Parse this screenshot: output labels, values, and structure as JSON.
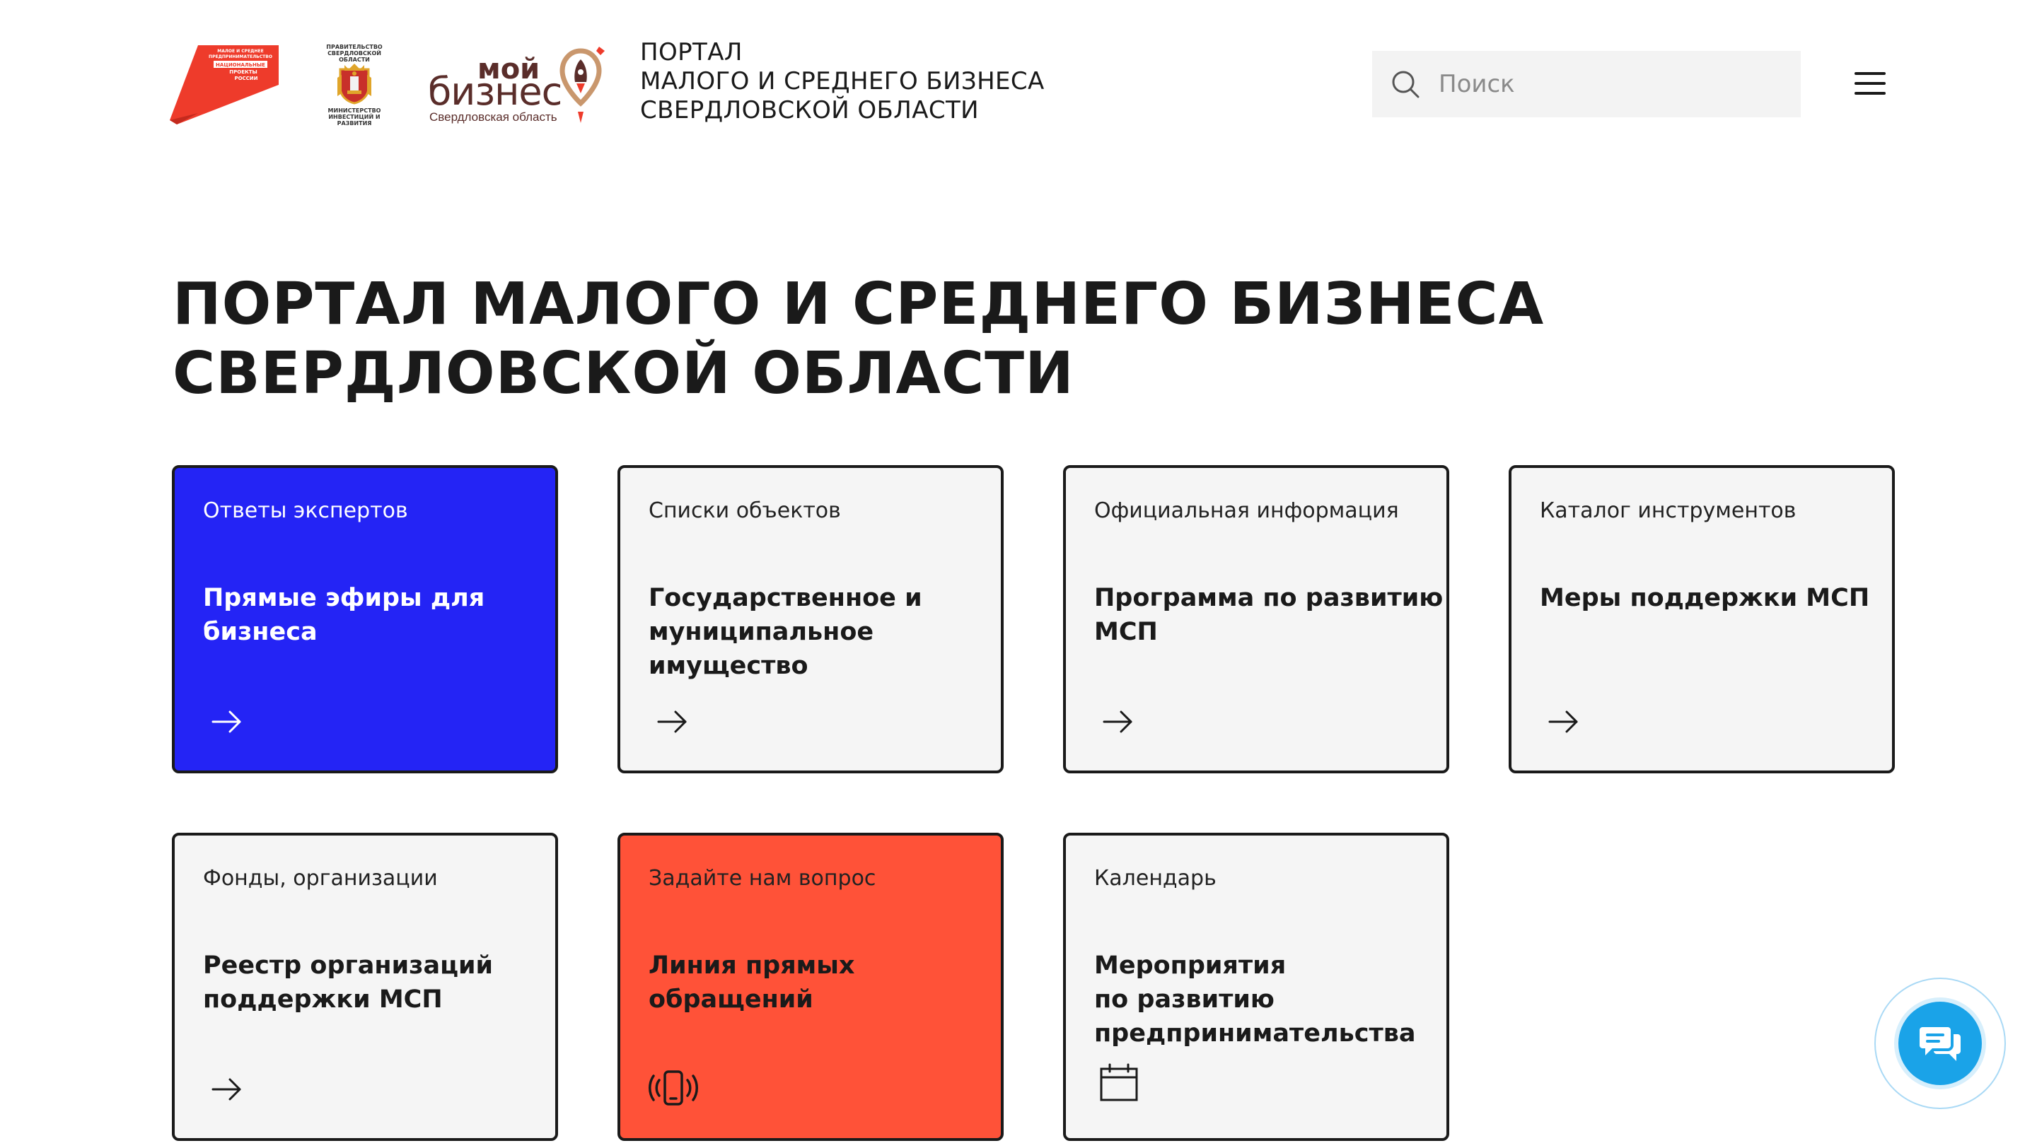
{
  "header": {
    "logo_np_lines": [
      "МАЛОЕ И СРЕДНЕЕ",
      "ПРЕДПРИНИМАТЕЛЬСТВО",
      "НАЦИОНАЛЬНЫЕ",
      "ПРОЕКТЫ",
      "РОССИИ"
    ],
    "gov_top": "ПРАВИТЕЛЬСТВО СВЕРДЛОВСКОЙ ОБЛАСТИ",
    "gov_bottom": "МИНИСТЕРСТВО ИНВЕСТИЦИЙ И РАЗВИТИЯ",
    "mb_moi": "мой",
    "mb_biz": "бизнес",
    "mb_region": "Свердловская область",
    "portal_title_lines": [
      "ПОРТАЛ",
      "МАЛОГО И СРЕДНЕГО БИЗНЕСА",
      "СВЕРДЛОВСКОЙ ОБЛАСТИ"
    ],
    "search_placeholder": "Поиск"
  },
  "main": {
    "title_lines": [
      "ПОРТАЛ МАЛОГО И СРЕДНЕГО БИЗНЕСА",
      "СВЕРДЛОВСКОЙ ОБЛАСТИ"
    ]
  },
  "cards": [
    {
      "category": "Ответы экспертов",
      "title_lines": [
        "Прямые эфиры для",
        "бизнеса"
      ],
      "icon": "arrow-right-icon"
    },
    {
      "category": "Списки объектов",
      "title_lines": [
        "Государственное и",
        "муниципальное",
        "имущество"
      ],
      "icon": "arrow-right-icon"
    },
    {
      "category": "Официальная информация",
      "title_lines": [
        "Программа по развитию",
        "МСП"
      ],
      "icon": "arrow-right-icon"
    },
    {
      "category": "Каталог инструментов",
      "title_lines": [
        "Меры поддержки МСП"
      ],
      "icon": "arrow-right-icon"
    },
    {
      "category": "Фонды, организации",
      "title_lines": [
        "Реестр организаций",
        "поддержки МСП"
      ],
      "icon": "arrow-right-icon"
    },
    {
      "category": "Задайте нам вопрос",
      "title_lines": [
        "Линия прямых",
        "обращений"
      ],
      "icon": "vibrating-phone-icon"
    },
    {
      "category": "Календарь",
      "title_lines": [
        "Мероприятия",
        "по развитию",
        "предпринимательства"
      ],
      "icon": "calendar-icon"
    }
  ],
  "colors": {
    "card_blue": "#2424f5",
    "card_red": "#ff5238",
    "card_default": "#f5f5f5",
    "chat_blue": "#1aa3e8",
    "np_red": "#ee3b2b",
    "mb_brown": "#5a2d2a"
  }
}
